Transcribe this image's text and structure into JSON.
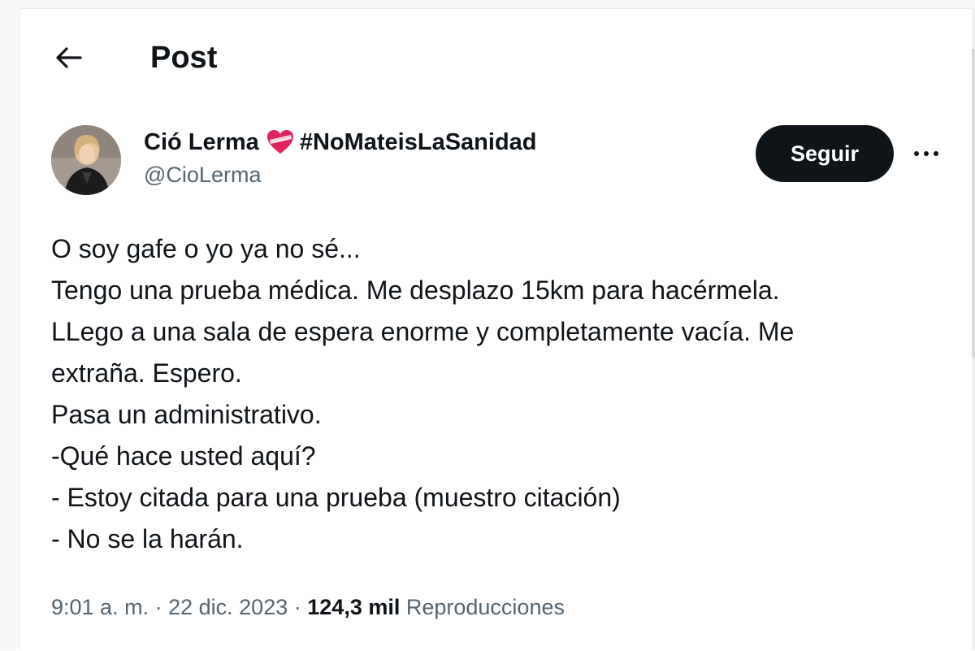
{
  "header": {
    "title": "Post"
  },
  "author": {
    "name": "Ció Lerma",
    "hashtag": "#NoMateisLaSanidad",
    "handle": "@CioLerma",
    "badge_icon": "red-heart-bandage-emoji"
  },
  "actions": {
    "follow_label": "Seguir"
  },
  "tweet": {
    "lines": [
      "O soy gafe o yo ya no sé...",
      "Tengo una prueba médica. Me desplazo 15km para hacérmela.",
      "LLego a una sala de espera enorme y completamente vacía. Me",
      "extraña. Espero.",
      "Pasa un administrativo.",
      "-Qué hace usted aquí?",
      "- Estoy citada para una prueba (muestro citación)",
      "- No se la harán."
    ]
  },
  "meta": {
    "time": "9:01 a. m.",
    "separator": "·",
    "date": "22 dic. 2023",
    "views_count": "124,3 mil",
    "views_label": "Reproducciones"
  },
  "colors": {
    "text_primary": "#0f1419",
    "text_secondary": "#536471",
    "follow_bg": "#0f1419",
    "heart": "#e0245e"
  }
}
